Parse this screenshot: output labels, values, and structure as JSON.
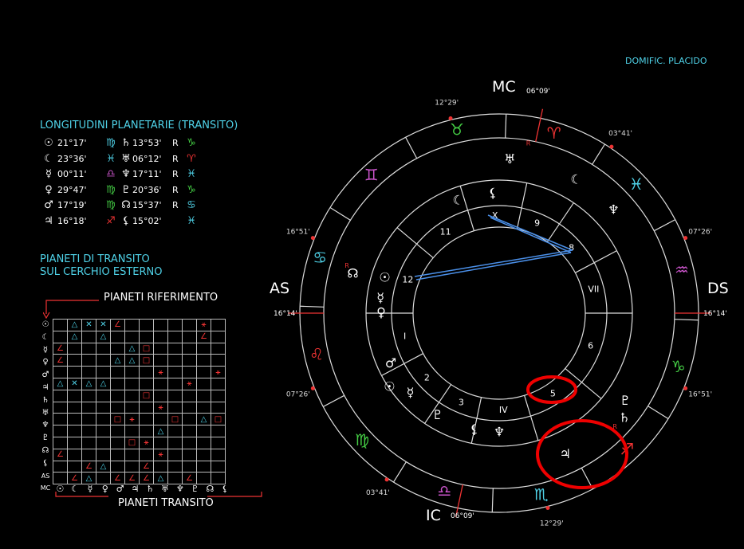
{
  "header": {
    "house_system": "DOMIFIC. PLACIDO"
  },
  "longitudes": {
    "title": "LONGITUDINI PLANETARIE (TRANSITO)",
    "rows": [
      {
        "glyph": "☉",
        "deg": "21°17'",
        "sign": "♍",
        "glyph2": "♄",
        "deg2": "13°53'",
        "r": "R",
        "sign2": "♑",
        "c1": "#4fd2e8",
        "c2": "#4c4"
      },
      {
        "glyph": "☾",
        "deg": "23°36'",
        "sign": "♓",
        "glyph2": "♅",
        "deg2": "06°12'",
        "r": "R",
        "sign2": "♈",
        "c1": "#4fd2e8",
        "c2": "#e33"
      },
      {
        "glyph": "☿",
        "deg": "00°11'",
        "sign": "♎",
        "glyph2": "♆",
        "deg2": "17°11'",
        "r": "R",
        "sign2": "♓",
        "c1": "#c5c",
        "c2": "#4fd2e8"
      },
      {
        "glyph": "♀",
        "deg": "29°47'",
        "sign": "♍",
        "glyph2": "♇",
        "deg2": "20°36'",
        "r": "R",
        "sign2": "♑",
        "c1": "#4c4",
        "c2": "#4c4"
      },
      {
        "glyph": "♂",
        "deg": "17°19'",
        "sign": "♍",
        "glyph2": "☊",
        "deg2": "15°37'",
        "r": "R",
        "sign2": "♋",
        "c1": "#4c4",
        "c2": "#4fd2e8"
      },
      {
        "glyph": "♃",
        "deg": "16°18'",
        "sign": "♐",
        "glyph2": "⚸",
        "deg2": "15°02'",
        "r": "",
        "sign2": "♓",
        "c1": "#e33",
        "c2": "#4fd2e8"
      }
    ]
  },
  "transit_note": {
    "line1": "PIANETI DI TRANSITO",
    "line2": "SUL CERCHIO ESTERNO"
  },
  "aspect_grid": {
    "ref_label": "PIANETI RIFERIMENTO",
    "transit_label": "PIANETI TRANSITO",
    "row_labels": [
      "☉",
      "☾",
      "☿",
      "♀",
      "♂",
      "♃",
      "♄",
      "♅",
      "♆",
      "♇",
      "☊",
      "⚸",
      "AS",
      "MC"
    ],
    "col_labels": [
      "☉",
      "☾",
      "☿",
      "♀",
      "♂",
      "♃",
      "♄",
      "♅",
      "♆",
      "♇",
      "☊",
      "⚸"
    ],
    "cells": [
      [
        "",
        "△",
        "✕",
        "✕",
        "∠",
        "",
        "",
        "",
        "",
        "",
        "⚹",
        ""
      ],
      [
        "",
        "△",
        "",
        "△",
        "",
        "",
        "",
        "",
        "",
        "",
        "∠",
        ""
      ],
      [
        "∠",
        "",
        "",
        "",
        "",
        "△",
        "□",
        "",
        "",
        "",
        "",
        ""
      ],
      [
        "∠",
        "",
        "",
        "",
        "△",
        "△",
        "□",
        "",
        "",
        "",
        "",
        ""
      ],
      [
        "",
        "",
        "",
        "",
        "",
        "",
        "",
        "⚹",
        "",
        "",
        "",
        "⚹"
      ],
      [
        "△",
        "✕",
        "△",
        "△",
        "",
        "",
        "",
        "",
        "",
        "⚹",
        "",
        ""
      ],
      [
        "",
        "",
        "",
        "",
        "",
        "",
        "□",
        "",
        "",
        "",
        "",
        ""
      ],
      [
        "",
        "",
        "",
        "",
        "",
        "",
        "",
        "⚹",
        "",
        "",
        "",
        ""
      ],
      [
        "",
        "",
        "",
        "",
        "□",
        "⚹",
        "",
        "",
        "□",
        "",
        "△",
        "□"
      ],
      [
        "",
        "",
        "",
        "",
        "",
        "",
        "",
        "△",
        "",
        "",
        "",
        ""
      ],
      [
        "",
        "",
        "",
        "",
        "",
        "□",
        "⚹",
        "",
        "",
        "",
        "",
        ""
      ],
      [
        "∠",
        "",
        "",
        "",
        "",
        "",
        "",
        "⚹",
        "",
        "",
        "",
        ""
      ],
      [
        "",
        "",
        "∠",
        "△",
        "",
        "",
        "∠",
        "",
        "",
        "",
        "",
        ""
      ],
      [
        "",
        "∠",
        "△",
        "",
        "∠",
        "∠",
        "∠",
        "△",
        "",
        "∠",
        "",
        ""
      ]
    ],
    "cell_colors": {
      "∠": "#e33",
      "□": "#e33",
      "⚹": "#e33",
      "△": "#4fd2e8",
      "✕": "#4fd2e8"
    }
  },
  "wheel": {
    "angles": {
      "as": "AS",
      "ds": "DS",
      "mc": "MC",
      "ic": "IC"
    },
    "angle_degrees": {
      "as": "16°14'",
      "ds": "16°14'",
      "mc": "06°09'",
      "ic": "06°09'"
    },
    "cusp_degrees": [
      "12°29'",
      "03°41'",
      "07°26'",
      "16°51'",
      "12°29'",
      "03°41'",
      "07°26'",
      "16°51'"
    ],
    "houses": [
      "I",
      "2",
      "3",
      "IV",
      "5",
      "6",
      "VII",
      "8",
      "9",
      "X",
      "11",
      "12"
    ],
    "signs": [
      "♈",
      "♉",
      "♊",
      "♋",
      "♌",
      "♍",
      "♎",
      "♏",
      "♐",
      "♑",
      "♒",
      "♓"
    ],
    "sign_colors": [
      "#e33",
      "#4c4",
      "#c5c",
      "#4fd2e8",
      "#e33",
      "#4c4",
      "#c5c",
      "#4fd2e8",
      "#e33",
      "#4c4",
      "#c5c",
      "#4fd2e8"
    ],
    "retro_mark": "R"
  }
}
